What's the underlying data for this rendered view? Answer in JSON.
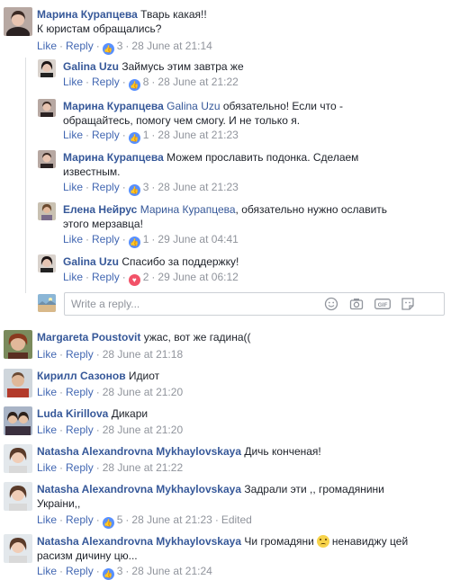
{
  "comments": [
    {
      "name": "Марина Курапцева",
      "text": "Тварь какая!!\nК юристам обращались?",
      "like": "Like",
      "reply": "Reply",
      "reaction": "like",
      "count": "3",
      "time": "28 June at 21:14"
    }
  ],
  "replies": [
    {
      "name": "Galina Uzu",
      "text": "Займусь этим завтра же",
      "like": "Like",
      "reply": "Reply",
      "reaction": "like",
      "count": "8",
      "time": "28 June at 21:22"
    },
    {
      "name": "Марина Курапцева",
      "mention": "Galina Uzu",
      "text": " обязательно! Если что -",
      "text2": "обращайтесь, помогу чем смогу. И не только я.",
      "like": "Like",
      "reply": "Reply",
      "reaction": "like",
      "count": "1",
      "time": "28 June at 21:23"
    },
    {
      "name": "Марина Курапцева",
      "text": "Можем прославить подонка. Сделаем",
      "text2": "известным.",
      "like": "Like",
      "reply": "Reply",
      "reaction": "like",
      "count": "3",
      "time": "28 June at 21:23"
    },
    {
      "name": "Елена Нейрус",
      "mention": "Марина Курапцева",
      "text": ", обязательно нужно ославить",
      "text2": "этого мерзавца!",
      "like": "Like",
      "reply": "Reply",
      "reaction": "like",
      "count": "1",
      "time": "29 June at 04:41"
    },
    {
      "name": "Galina Uzu",
      "text": "Спасибо за поддержку!",
      "like": "Like",
      "reply": "Reply",
      "reaction": "heart",
      "count": "2",
      "time": "29 June at 06:12"
    }
  ],
  "reply_box": {
    "placeholder": "Write a reply..."
  },
  "top_level": [
    {
      "name": "Margareta Poustovit",
      "text": "ужас, вот же гадина((",
      "like": "Like",
      "reply": "Reply",
      "time": "28 June at 21:18"
    },
    {
      "name": "Кирилл Сазонов",
      "text": "Идиот",
      "like": "Like",
      "reply": "Reply",
      "time": "28 June at 21:20"
    },
    {
      "name": "Luda Kirillova",
      "text": "Дикари",
      "like": "Like",
      "reply": "Reply",
      "time": "28 June at 21:20"
    },
    {
      "name": "Natasha Alexandrovna Mykhaylovskaya",
      "text": "Дичь конченая!",
      "like": "Like",
      "reply": "Reply",
      "time": "28 June at 21:22"
    },
    {
      "name": "Natasha Alexandrovna Mykhaylovskaya",
      "text": "Задрали эти ,, громадянини",
      "text2": "Украіни,,",
      "like": "Like",
      "reply": "Reply",
      "reaction": "like",
      "count": "5",
      "time": "28 June at 21:23",
      "edited": "Edited"
    },
    {
      "name": "Natasha Alexandrovna Mykhaylovskaya",
      "text": "Чи громадяни",
      "text_after": "ненавиджу цей",
      "text2": "расизм дичину цю...",
      "like": "Like",
      "reply": "Reply",
      "reaction": "like",
      "count": "3",
      "time": "28 June at 21:24"
    }
  ],
  "colors": {
    "link": "#365899",
    "action": "#4267b2",
    "meta": "#90949c",
    "like_badge": "#5890ff",
    "heart_badge": "#f25268"
  },
  "icons": [
    "like-reaction-icon",
    "heart-reaction-icon",
    "emoji-icon",
    "camera-icon",
    "gif-icon",
    "sticker-icon",
    "sad-emoji-icon"
  ]
}
